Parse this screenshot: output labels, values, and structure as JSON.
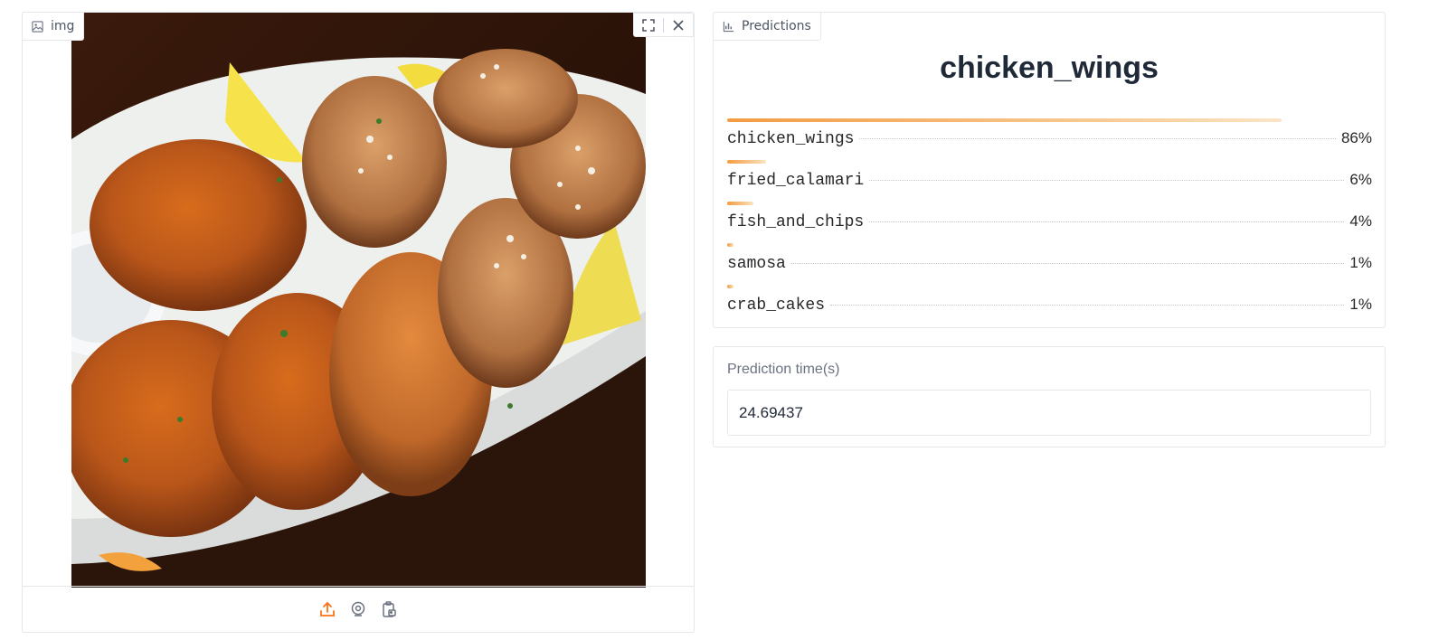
{
  "image_panel": {
    "label": "img",
    "photo_alt": "plate of chicken wings with lemon wedges and dip"
  },
  "predictions_panel": {
    "label": "Predictions",
    "top_label": "chicken_wings",
    "confidences": [
      {
        "label": "chicken_wings",
        "value_text": "86%",
        "fraction": 0.86
      },
      {
        "label": "fried_calamari",
        "value_text": "6%",
        "fraction": 0.06
      },
      {
        "label": "fish_and_chips",
        "value_text": "4%",
        "fraction": 0.04
      },
      {
        "label": "samosa",
        "value_text": "1%",
        "fraction": 0.01
      },
      {
        "label": "crab_cakes",
        "value_text": "1%",
        "fraction": 0.01
      }
    ]
  },
  "time_panel": {
    "label": "Prediction time(s)",
    "value": "24.69437"
  },
  "colors": {
    "accent": "#f97316",
    "bar_start": "#f39c42",
    "bar_end": "#fbe5c8",
    "border": "#e5e7eb"
  }
}
